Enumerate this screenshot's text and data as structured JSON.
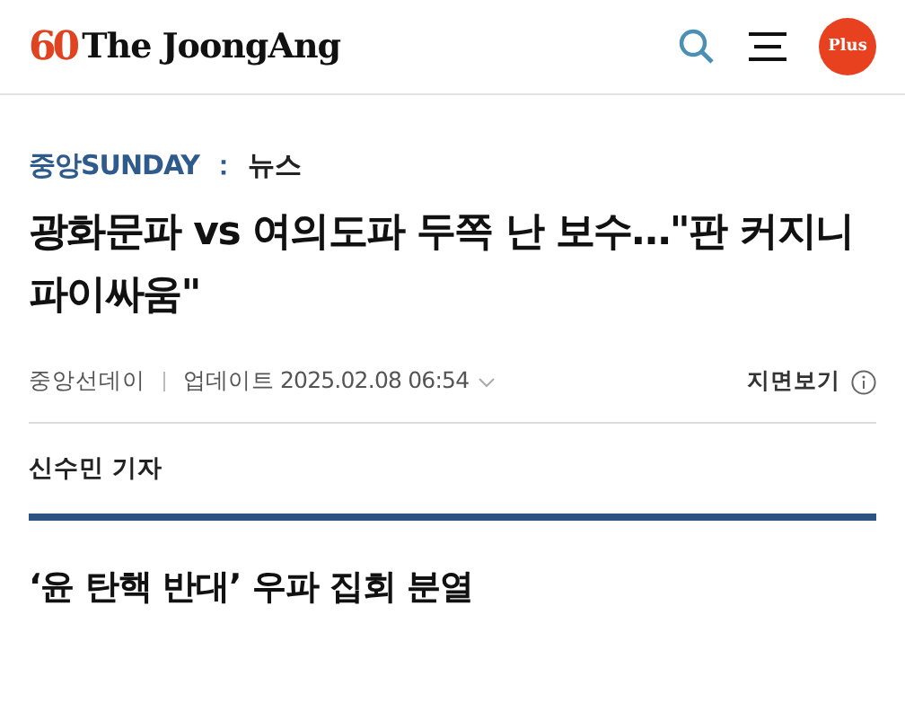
{
  "header": {
    "logo_mark": "60",
    "logo_text": "The JoongAng",
    "plus_button": "Plus"
  },
  "article": {
    "section": "중앙SUNDAY",
    "separator": "：",
    "category": "뉴스",
    "title": "광화문파 vs 여의도파 두쪽 난 보수…\"판 커지니 파이싸움\"",
    "source": "중앙선데이",
    "updated": "업데이트 2025.02.08 06:54",
    "print_view": "지면보기",
    "reporter": "신수민 기자",
    "subtitle": "‘윤 탄핵 반대’ 우파 집회 분열"
  }
}
